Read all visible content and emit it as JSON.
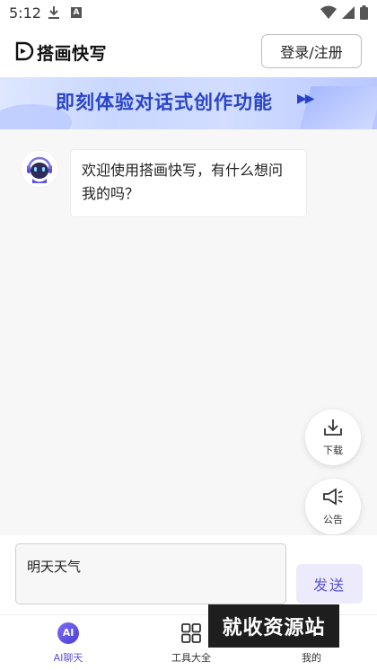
{
  "status_bar": {
    "time": "5:12",
    "a_badge": "A"
  },
  "header": {
    "app_name": "搭画快写",
    "login_label": "登录/注册"
  },
  "banner": {
    "text": "即刻体验对话式创作功能",
    "arrows": "▶▶"
  },
  "chat": {
    "messages": [
      {
        "sender": "bot",
        "text": "欢迎使用搭画快写，有什么想问我的吗？"
      }
    ]
  },
  "float_buttons": {
    "download_label": "下载",
    "notice_label": "公告"
  },
  "input": {
    "value": "明天天气",
    "send_label": "发送"
  },
  "bottom_nav": {
    "items": [
      {
        "label": "AI聊天",
        "icon": "ai-chat-icon",
        "badge": "AI",
        "active": true
      },
      {
        "label": "工具大全",
        "icon": "grid-icon",
        "active": false
      },
      {
        "label": "我的",
        "icon": "profile-icon",
        "active": false
      }
    ]
  },
  "watermark": "就收资源站",
  "colors": {
    "accent": "#5b53d9",
    "send_bg": "#ecebfb",
    "banner_text": "#2a44c8"
  }
}
